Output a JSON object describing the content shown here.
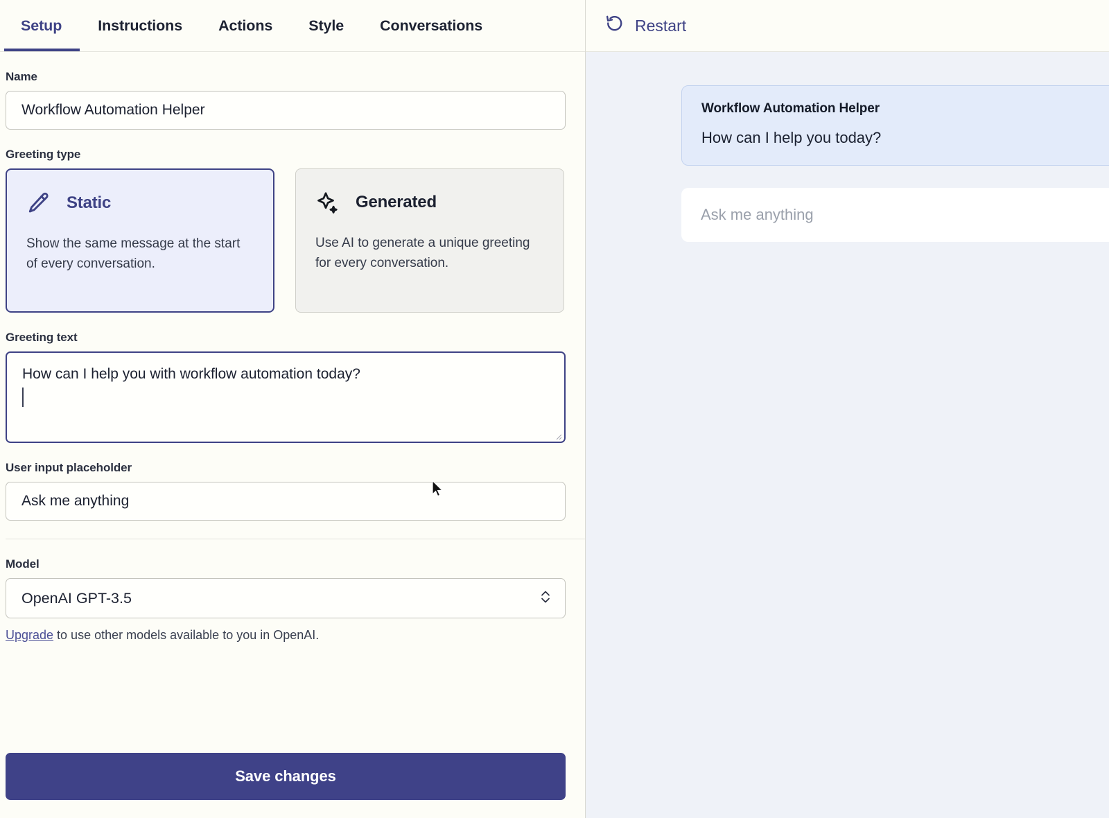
{
  "tabs": [
    {
      "label": "Setup",
      "active": true
    },
    {
      "label": "Instructions",
      "active": false
    },
    {
      "label": "Actions",
      "active": false
    },
    {
      "label": "Style",
      "active": false
    },
    {
      "label": "Conversations",
      "active": false
    }
  ],
  "form": {
    "name_label": "Name",
    "name_value": "Workflow Automation Helper",
    "greeting_type_label": "Greeting type",
    "greeting_types": [
      {
        "title": "Static",
        "description": "Show the same message at the start of every conversation.",
        "icon": "pencil-icon",
        "selected": true
      },
      {
        "title": "Generated",
        "description": "Use AI to generate a unique greeting for every conversation.",
        "icon": "sparkle-icon",
        "selected": false
      }
    ],
    "greeting_text_label": "Greeting text",
    "greeting_text_value": "How can I help you with workflow automation today?",
    "placeholder_label": "User input placeholder",
    "placeholder_value": "Ask me anything",
    "model_label": "Model",
    "model_value": "OpenAI GPT-3.5",
    "model_chevron_icon": "chevron-up-down-icon",
    "upgrade_link": "Upgrade",
    "upgrade_rest": " to use other models available to you in OpenAI.",
    "save_label": "Save changes"
  },
  "preview": {
    "restart_label": "Restart",
    "restart_icon": "restart-arrow-icon",
    "bubble_name": "Workflow Automation Helper",
    "bubble_message": "How can I help you today?",
    "input_placeholder": "Ask me anything"
  },
  "colors": {
    "accent": "#3e4285",
    "save_button": "#3f4288",
    "selected_card_bg": "#eceefb",
    "unselected_card_bg": "#f1f1ee",
    "bubble_bg": "#e3ebfa",
    "bubble_border": "#c3d3ef",
    "left_panel_bg": "#fdfdf7",
    "right_panel_bg": "#eff2f8",
    "link": "#4b4f96"
  }
}
